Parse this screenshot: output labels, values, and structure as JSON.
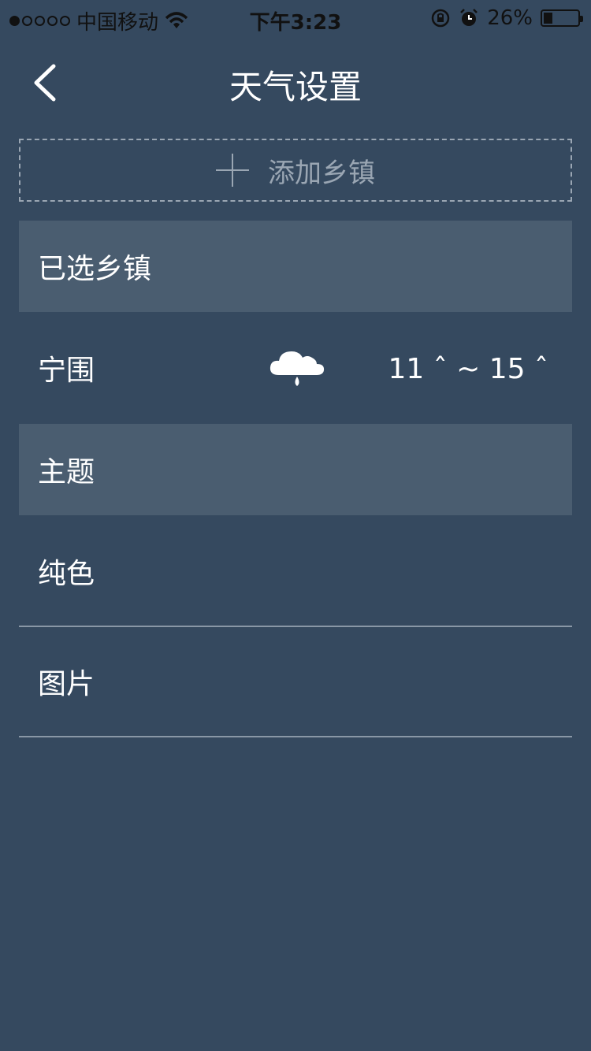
{
  "status_bar": {
    "carrier": "中国移动",
    "time": "下午3:23",
    "battery_percent": "26%",
    "battery_level": 0.26
  },
  "nav": {
    "title": "天气设置"
  },
  "add_town": {
    "label": "添加乡镇"
  },
  "selected_section": {
    "title": "已选乡镇",
    "towns": [
      {
        "name": "宁围",
        "weather_icon": "cloud-rain-icon",
        "temp_range": "11 ˆ ~ 15 ˆ"
      }
    ]
  },
  "theme_section": {
    "title": "主题",
    "options": [
      {
        "label": "纯色"
      },
      {
        "label": "图片"
      }
    ]
  },
  "colors": {
    "background": "#35495f",
    "section_header": "#4a5d70",
    "divider": "#8997a6",
    "muted_text": "#9aa6b3"
  }
}
